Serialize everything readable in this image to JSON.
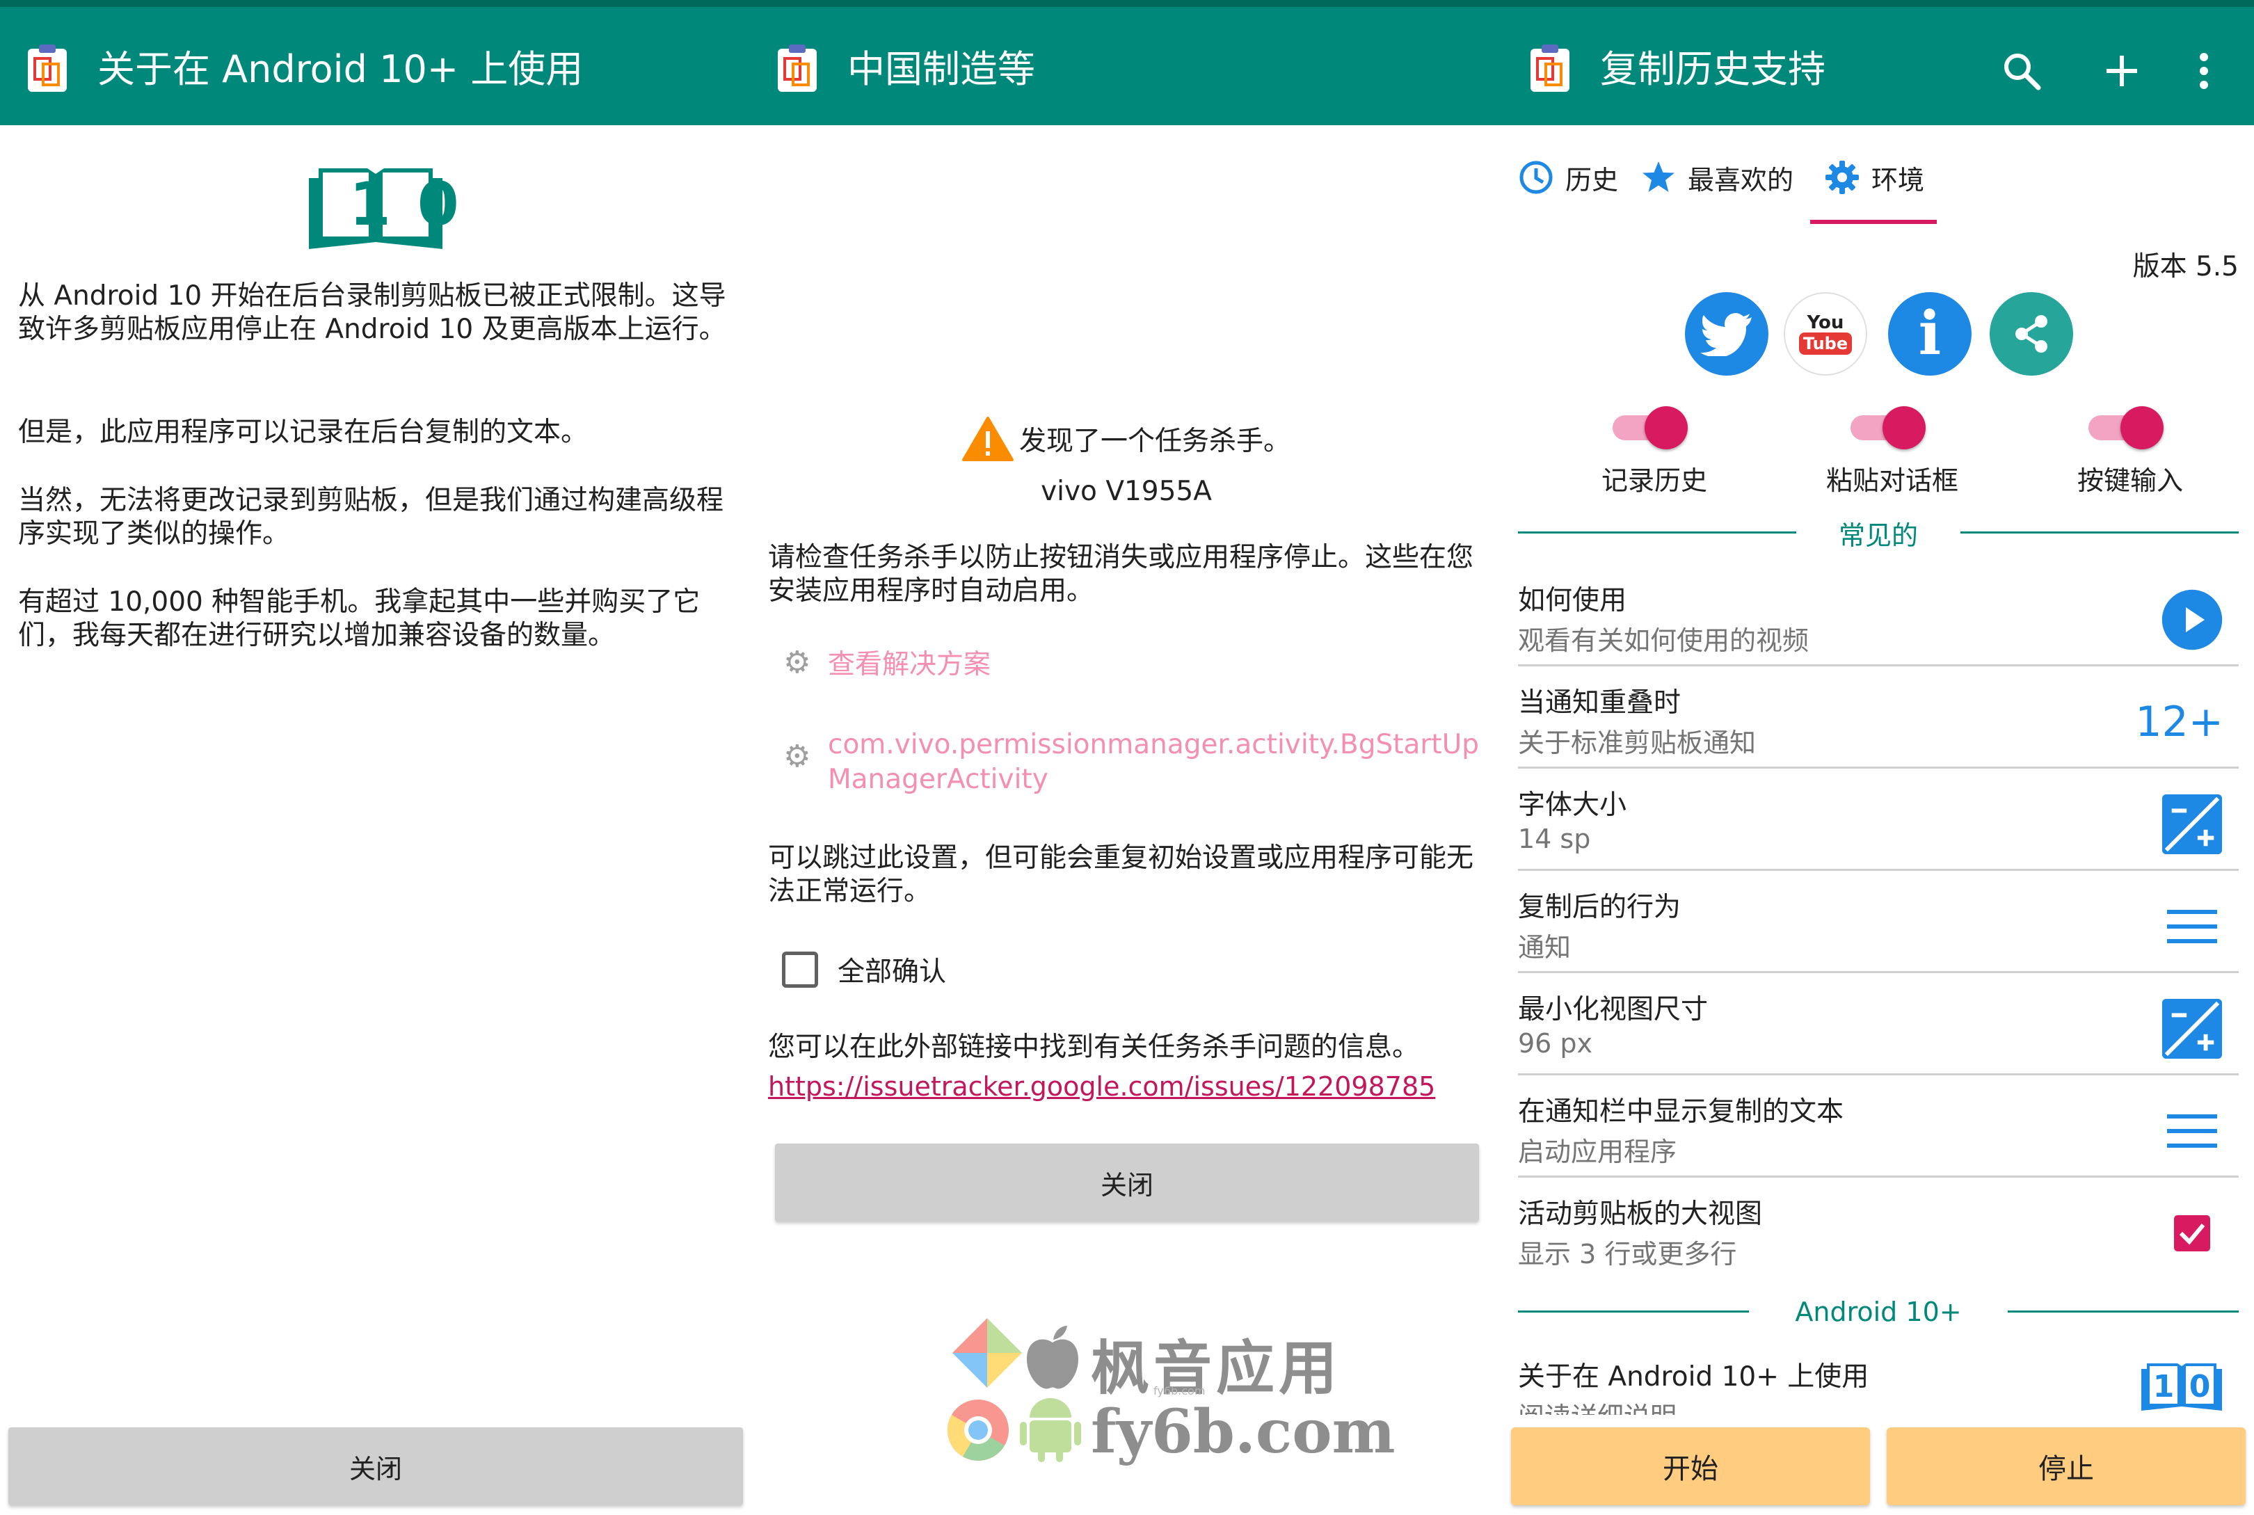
{
  "panel1": {
    "title": "关于在 Android 10+ 上使用",
    "book_number": "10",
    "paragraphs": [
      "从 Android 10 开始在后台录制剪贴板已被正式限制。这导致许多剪贴板应用停止在 Android 10 及更高版本上运行。",
      "但是，此应用程序可以记录在后台复制的文本。",
      "当然，无法将更改记录到剪贴板，但是我们通过构建高级程序实现了类似的操作。",
      "有超过 10,000 种智能手机。我拿起其中一些并购买了它们，我每天都在进行研究以增加兼容设备的数量。"
    ],
    "close_label": "关闭"
  },
  "panel2": {
    "title": "中国制造等",
    "warning_title": "发现了一个任务杀手。",
    "device": "vivo V1955A",
    "instruction": "请检查任务杀手以防止按钮消失或应用程序停止。这些在您安装应用程序时自动启用。",
    "solution_link": "查看解决方案",
    "activity_link": "com.vivo.permissionmanager.activity.BgStartUpManagerActivity",
    "skip_note": "可以跳过此设置，但可能会重复初始设置或应用程序可能无法正常运行。",
    "confirm_all": "全部确认",
    "external_note": "您可以在此外部链接中找到有关任务杀手问题的信息。",
    "url": "https://issuetracker.google.com/issues/122098785",
    "close_label": "关闭"
  },
  "watermark": {
    "cn": "枫音应用",
    "en": "fy6b.com",
    "small": "fy6b.com"
  },
  "panel3": {
    "title": "复制历史支持",
    "tabs": [
      "历史",
      "最喜欢的",
      "环境"
    ],
    "version": "版本 5.5",
    "youtube_top": "You",
    "youtube_bottom": "Tube",
    "info_glyph": "i",
    "switches": [
      "记录历史",
      "粘贴对话框",
      "按键输入"
    ],
    "section_common": "常见的",
    "rows": [
      {
        "title": "如何使用",
        "subtitle": "观看有关如何使用的视频"
      },
      {
        "title": "当通知重叠时",
        "subtitle": "关于标准剪贴板通知",
        "value": "12+"
      },
      {
        "title": "字体大小",
        "subtitle": "14 sp"
      },
      {
        "title": "复制后的行为",
        "subtitle": "通知"
      },
      {
        "title": "最小化视图尺寸",
        "subtitle": "96 px"
      },
      {
        "title": "在通知栏中显示复制的文本",
        "subtitle": "启动应用程序"
      },
      {
        "title": "活动剪贴板的大视图",
        "subtitle": "显示 3 行或更多行"
      }
    ],
    "section_android": "Android 10+",
    "last_row": {
      "title": "关于在 Android 10+ 上使用",
      "subtitle": "阅读详细说明"
    },
    "start_label": "开始",
    "stop_label": "停止",
    "colors": {
      "teal": "#00897b",
      "pink": "#d81b60",
      "blue": "#1e88e5",
      "orange_button": "#ffcc80"
    }
  }
}
